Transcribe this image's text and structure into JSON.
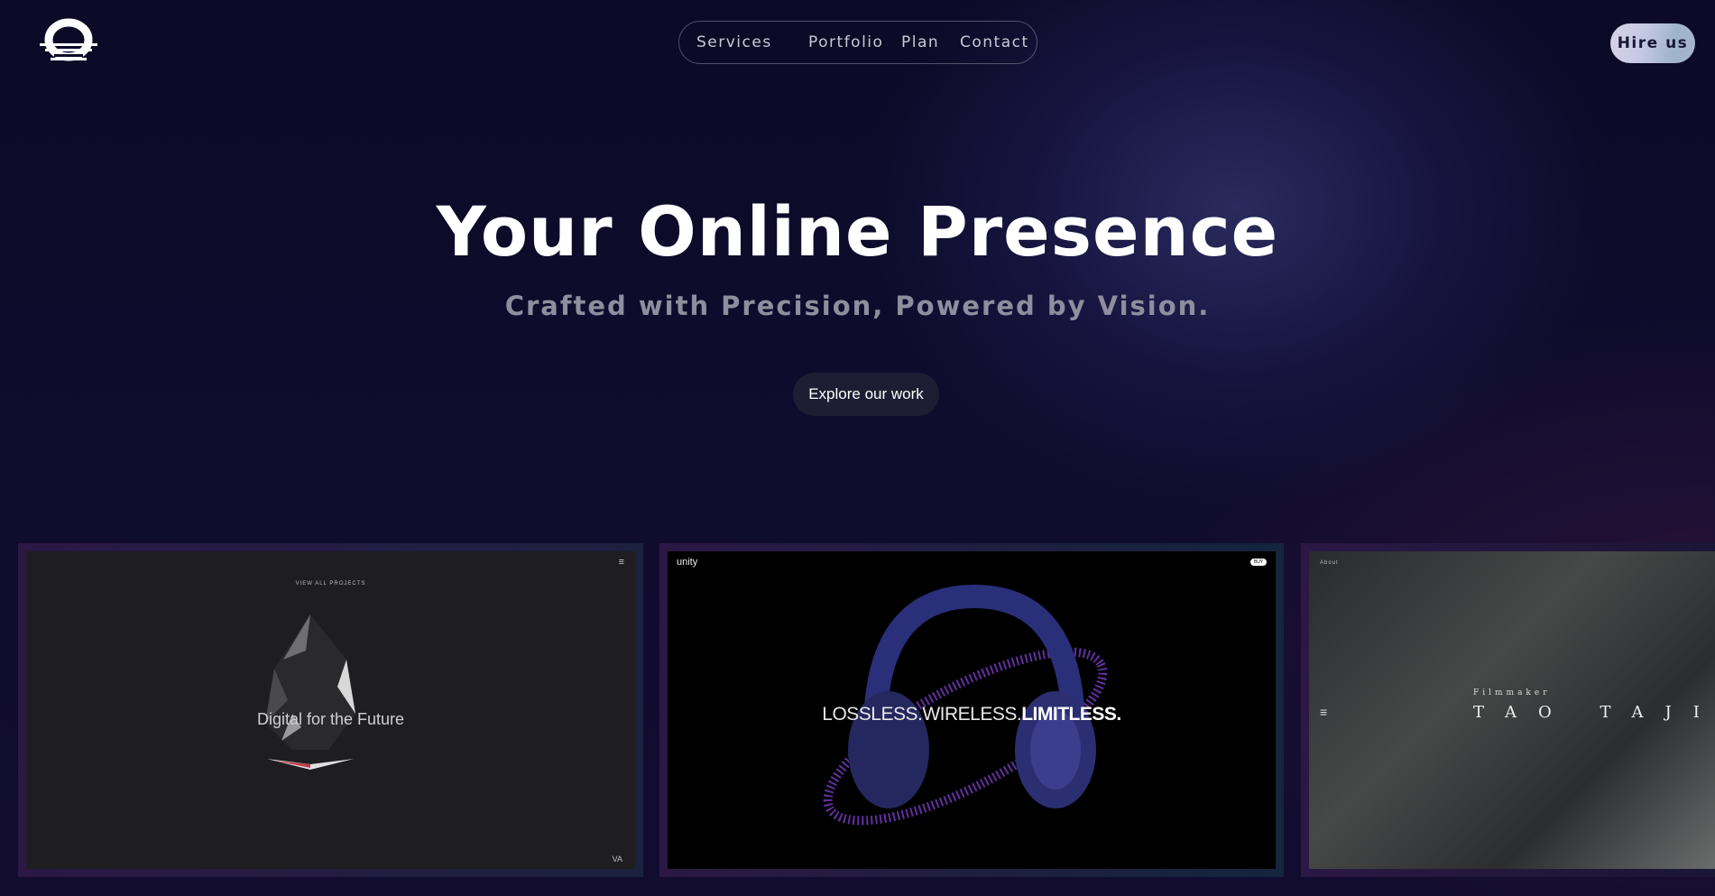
{
  "nav": {
    "items": [
      "Services",
      "Portfolio",
      "Plan",
      "Contact"
    ],
    "hire_label": "Hire us"
  },
  "hero": {
    "title": "Your Online Presence",
    "subtitle": "Crafted with Precision, Powered by Vision.",
    "cta_label": "Explore our work"
  },
  "portfolio": {
    "card1": {
      "top_text": "VIEW ALL PROJECTS",
      "headline": "Digital for the Future",
      "logo_mark": "VA"
    },
    "card2": {
      "brand": "unity",
      "badge": "BUY",
      "headline_light": "LOSSLESS.WIRELESS.",
      "headline_bold": "LIMITLESS."
    },
    "card3": {
      "nav_text": "About",
      "role": "Filmmaker",
      "name": "TAO TAJIMA"
    }
  },
  "colors": {
    "background": "#0f0c2e",
    "accent_button": "#c3c8e2"
  }
}
